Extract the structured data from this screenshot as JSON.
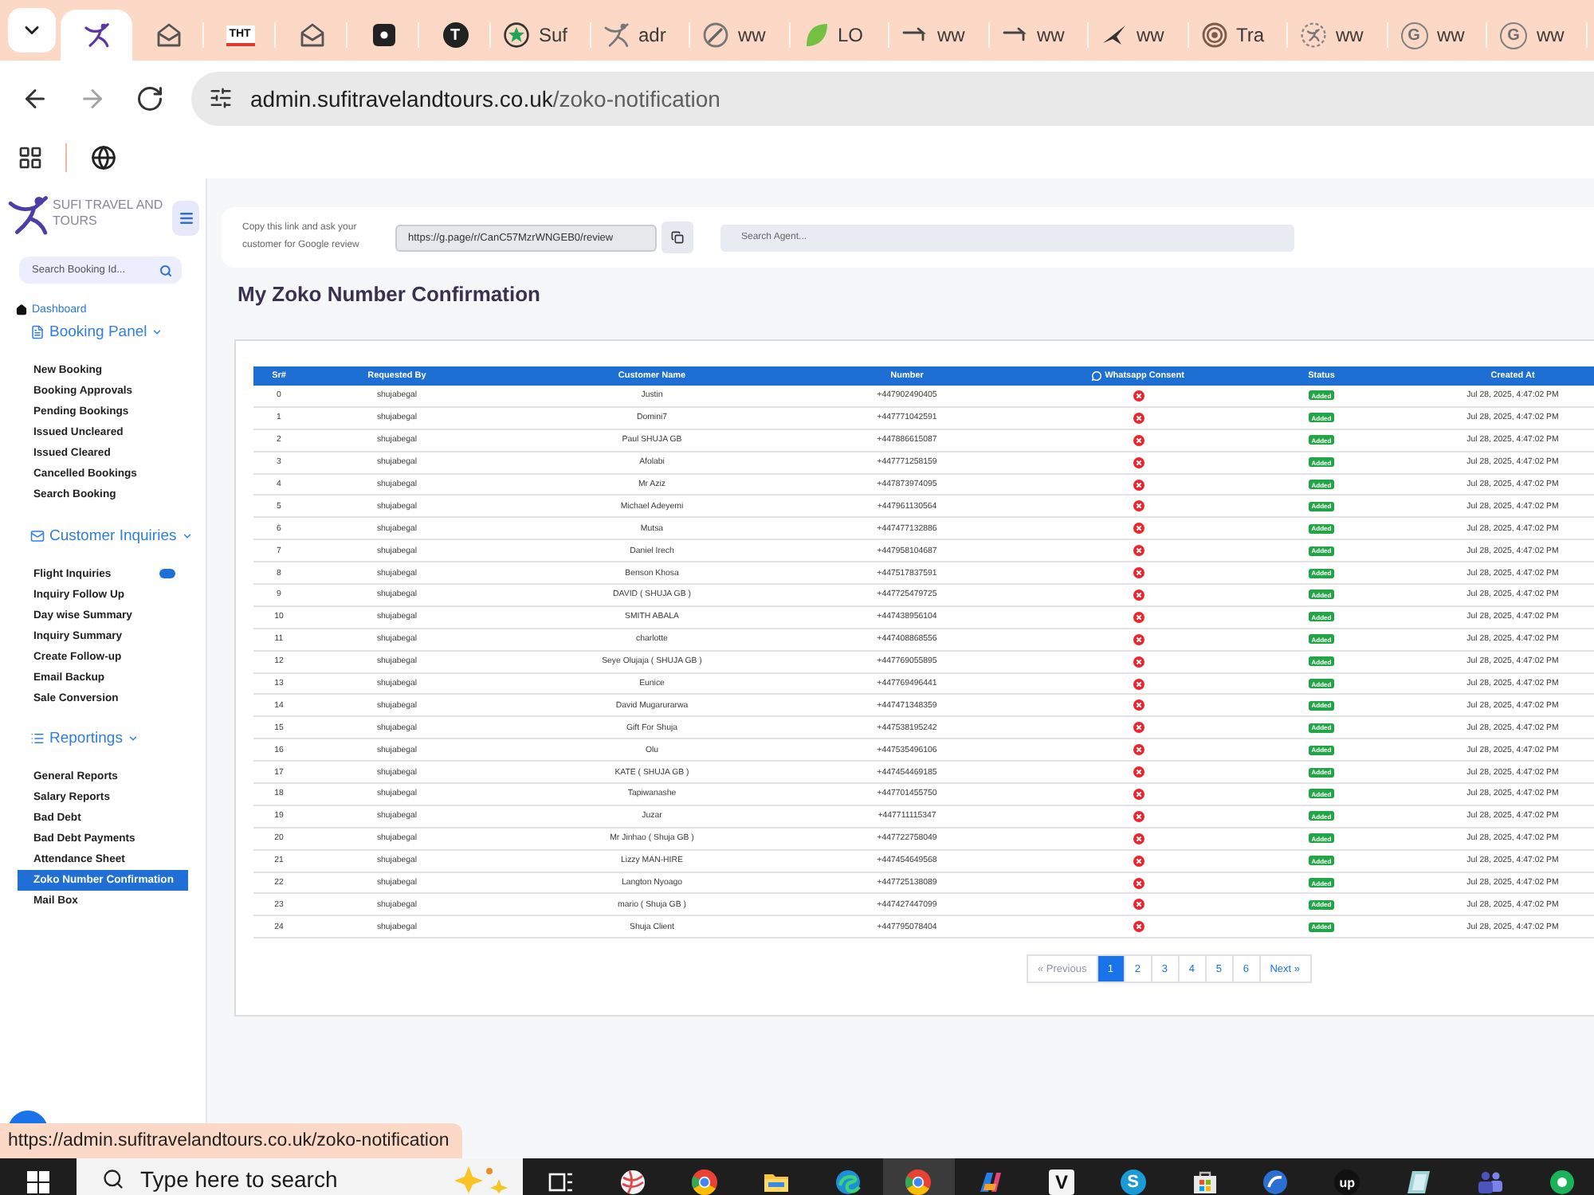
{
  "browser": {
    "tabs": [
      {
        "selected": true
      },
      {
        "selected": false
      },
      {
        "logo_text": "THT",
        "selected": false
      },
      {
        "selected": false
      },
      {
        "selected": false
      },
      {
        "logo_text": "T",
        "selected": false
      },
      {
        "title": "Suf",
        "selected": false
      },
      {
        "title": "adr",
        "selected": false
      },
      {
        "title": "ww",
        "selected": false
      },
      {
        "title": "LO",
        "selected": false
      },
      {
        "title": "ww",
        "selected": false
      },
      {
        "title": "ww",
        "selected": false
      },
      {
        "title": "ww",
        "selected": false
      },
      {
        "title": "Tra",
        "selected": false
      },
      {
        "title": "ww",
        "selected": false
      },
      {
        "logo_text": "G",
        "title": "ww",
        "selected": false
      },
      {
        "logo_text": "G",
        "title": "ww",
        "selected": false
      }
    ],
    "nav": [
      {
        "kind": "back",
        "disabled": false
      },
      {
        "kind": "forward",
        "disabled": true
      },
      {
        "kind": "reload",
        "disabled": false
      }
    ],
    "address": {
      "host": "admin.sufitravelandtours.co.uk",
      "path": "/zoko-notification"
    },
    "status_url": "https://admin.sufitravelandtours.co.uk/zoko-notification"
  },
  "sidebar": {
    "brand": "SUFI TRAVEL AND TOURS",
    "search": {
      "placeholder": "Search Booking Id..."
    },
    "dashboard": "Dashboard",
    "sections": [
      {
        "title": "Booking Panel",
        "expanded": true,
        "items": [
          {
            "label": "New Booking",
            "selected": false,
            "badge": false
          },
          {
            "label": "Booking Approvals",
            "selected": false,
            "badge": false
          },
          {
            "label": "Pending Bookings",
            "selected": false,
            "badge": false
          },
          {
            "label": "Issued Uncleared",
            "selected": false,
            "badge": false
          },
          {
            "label": "Issued Cleared",
            "selected": false,
            "badge": false
          },
          {
            "label": "Cancelled Bookings",
            "selected": false,
            "badge": false
          },
          {
            "label": "Search Booking",
            "selected": false,
            "badge": false
          }
        ]
      },
      {
        "title": "Customer Inquiries",
        "expanded": true,
        "items": [
          {
            "label": "Flight Inquiries",
            "selected": false,
            "badge": true
          },
          {
            "label": "Inquiry Follow Up",
            "selected": false,
            "badge": false
          },
          {
            "label": "Day wise Summary",
            "selected": false,
            "badge": false
          },
          {
            "label": "Inquiry Summary",
            "selected": false,
            "badge": false
          },
          {
            "label": "Create Follow-up",
            "selected": false,
            "badge": false
          },
          {
            "label": "Email Backup",
            "selected": false,
            "badge": false
          },
          {
            "label": "Sale Conversion",
            "selected": false,
            "badge": false
          }
        ]
      },
      {
        "title": "Reportings",
        "expanded": true,
        "items": [
          {
            "label": "General Reports",
            "selected": false,
            "badge": false
          },
          {
            "label": "Salary Reports",
            "selected": false,
            "badge": false
          },
          {
            "label": "Bad Debt",
            "selected": false,
            "badge": false
          },
          {
            "label": "Bad Debt Payments",
            "selected": false,
            "badge": false
          },
          {
            "label": "Attendance Sheet",
            "selected": false,
            "badge": false
          },
          {
            "label": "Zoko Number Confirmation",
            "selected": true,
            "badge": false
          },
          {
            "label": "Mail Box",
            "selected": false,
            "badge": false
          }
        ]
      }
    ]
  },
  "review": {
    "hint": "Copy this link and ask your customer for Google review",
    "link": "https://g.page/r/CanC57MzrWNGEB0/review"
  },
  "agent_search": {
    "placeholder": "Search Agent..."
  },
  "page_title": "My Zoko Number Confirmation",
  "table": {
    "columns": [
      "Sr#",
      "Requested By",
      "Customer Name",
      "Number",
      "Whatsapp Consent",
      "Status",
      "Created At"
    ],
    "rows": [
      {
        "sr": "0",
        "requested_by": "shujabegal",
        "customer": "Justin",
        "number": "+447902490405",
        "consent": false,
        "status": "Added",
        "created": "Jul 28, 2025, 4:47:02 PM"
      },
      {
        "sr": "1",
        "requested_by": "shujabegal",
        "customer": "Domini7",
        "number": "+447771042591",
        "consent": false,
        "status": "Added",
        "created": "Jul 28, 2025, 4:47:02 PM"
      },
      {
        "sr": "2",
        "requested_by": "shujabegal",
        "customer": "Paul SHUJA GB",
        "number": "+447886615087",
        "consent": false,
        "status": "Added",
        "created": "Jul 28, 2025, 4:47:02 PM"
      },
      {
        "sr": "3",
        "requested_by": "shujabegal",
        "customer": "Afolabi",
        "number": "+447771258159",
        "consent": false,
        "status": "Added",
        "created": "Jul 28, 2025, 4:47:02 PM"
      },
      {
        "sr": "4",
        "requested_by": "shujabegal",
        "customer": "Mr Aziz",
        "number": "+447873974095",
        "consent": false,
        "status": "Added",
        "created": "Jul 28, 2025, 4:47:02 PM"
      },
      {
        "sr": "5",
        "requested_by": "shujabegal",
        "customer": "Michael Adeyemi",
        "number": "+447961130564",
        "consent": false,
        "status": "Added",
        "created": "Jul 28, 2025, 4:47:02 PM"
      },
      {
        "sr": "6",
        "requested_by": "shujabegal",
        "customer": "Mutsa",
        "number": "+447477132886",
        "consent": false,
        "status": "Added",
        "created": "Jul 28, 2025, 4:47:02 PM"
      },
      {
        "sr": "7",
        "requested_by": "shujabegal",
        "customer": "Daniel Irech",
        "number": "+447958104687",
        "consent": false,
        "status": "Added",
        "created": "Jul 28, 2025, 4:47:02 PM"
      },
      {
        "sr": "8",
        "requested_by": "shujabegal",
        "customer": "Benson Khosa",
        "number": "+447517837591",
        "consent": false,
        "status": "Added",
        "created": "Jul 28, 2025, 4:47:02 PM"
      },
      {
        "sr": "9",
        "requested_by": "shujabegal",
        "customer": "DAVID ( SHUJA GB )",
        "number": "+447725479725",
        "consent": false,
        "status": "Added",
        "created": "Jul 28, 2025, 4:47:02 PM"
      },
      {
        "sr": "10",
        "requested_by": "shujabegal",
        "customer": "SMITH ABALA",
        "number": "+447438956104",
        "consent": false,
        "status": "Added",
        "created": "Jul 28, 2025, 4:47:02 PM"
      },
      {
        "sr": "11",
        "requested_by": "shujabegal",
        "customer": "charlotte",
        "number": "+447408868556",
        "consent": false,
        "status": "Added",
        "created": "Jul 28, 2025, 4:47:02 PM"
      },
      {
        "sr": "12",
        "requested_by": "shujabegal",
        "customer": "Seye Olujaja ( SHUJA GB )",
        "number": "+447769055895",
        "consent": false,
        "status": "Added",
        "created": "Jul 28, 2025, 4:47:02 PM"
      },
      {
        "sr": "13",
        "requested_by": "shujabegal",
        "customer": "Eunice",
        "number": "+447769496441",
        "consent": false,
        "status": "Added",
        "created": "Jul 28, 2025, 4:47:02 PM"
      },
      {
        "sr": "14",
        "requested_by": "shujabegal",
        "customer": "David Mugarurarwa",
        "number": "+447471348359",
        "consent": false,
        "status": "Added",
        "created": "Jul 28, 2025, 4:47:02 PM"
      },
      {
        "sr": "15",
        "requested_by": "shujabegal",
        "customer": "Gift For Shuja",
        "number": "+447538195242",
        "consent": false,
        "status": "Added",
        "created": "Jul 28, 2025, 4:47:02 PM"
      },
      {
        "sr": "16",
        "requested_by": "shujabegal",
        "customer": "Olu",
        "number": "+447535496106",
        "consent": false,
        "status": "Added",
        "created": "Jul 28, 2025, 4:47:02 PM"
      },
      {
        "sr": "17",
        "requested_by": "shujabegal",
        "customer": "KATE ( SHUJA GB )",
        "number": "+447454469185",
        "consent": false,
        "status": "Added",
        "created": "Jul 28, 2025, 4:47:02 PM"
      },
      {
        "sr": "18",
        "requested_by": "shujabegal",
        "customer": "Tapiwanashe",
        "number": "+447701455750",
        "consent": false,
        "status": "Added",
        "created": "Jul 28, 2025, 4:47:02 PM"
      },
      {
        "sr": "19",
        "requested_by": "shujabegal",
        "customer": "Juzar",
        "number": "+447711115347",
        "consent": false,
        "status": "Added",
        "created": "Jul 28, 2025, 4:47:02 PM"
      },
      {
        "sr": "20",
        "requested_by": "shujabegal",
        "customer": "Mr Jinhao ( Shuja GB )",
        "number": "+447722758049",
        "consent": false,
        "status": "Added",
        "created": "Jul 28, 2025, 4:47:02 PM"
      },
      {
        "sr": "21",
        "requested_by": "shujabegal",
        "customer": "Lizzy MAN-HIRE",
        "number": "+447454649568",
        "consent": false,
        "status": "Added",
        "created": "Jul 28, 2025, 4:47:02 PM"
      },
      {
        "sr": "22",
        "requested_by": "shujabegal",
        "customer": "Langton Nyoago",
        "number": "+447725138089",
        "consent": false,
        "status": "Added",
        "created": "Jul 28, 2025, 4:47:02 PM"
      },
      {
        "sr": "23",
        "requested_by": "shujabegal",
        "customer": "mario ( Shuja GB )",
        "number": "+447427447099",
        "consent": false,
        "status": "Added",
        "created": "Jul 28, 2025, 4:47:02 PM"
      },
      {
        "sr": "24",
        "requested_by": "shujabegal",
        "customer": "Shuja Client",
        "number": "+447795078404",
        "consent": false,
        "status": "Added",
        "created": "Jul 28, 2025, 4:47:02 PM"
      }
    ]
  },
  "pagination": {
    "previous": {
      "label": "« Previous",
      "disabled": true
    },
    "pages": [
      {
        "label": "1",
        "selected": true
      },
      {
        "label": "2",
        "selected": false
      },
      {
        "label": "3",
        "selected": false
      },
      {
        "label": "4",
        "selected": false
      },
      {
        "label": "5",
        "selected": false
      },
      {
        "label": "6",
        "selected": false
      }
    ],
    "next": {
      "label": "Next »",
      "disabled": false
    }
  },
  "taskbar": {
    "search": {
      "placeholder": "Type here to search"
    },
    "apps": [
      {
        "selected": false
      },
      {
        "selected": false
      },
      {
        "selected": false
      },
      {
        "selected": false
      },
      {
        "selected": false
      },
      {
        "selected": true
      },
      {
        "selected": false
      },
      {
        "logo_text": "V",
        "selected": false
      },
      {
        "logo_text": "S",
        "selected": false
      },
      {
        "selected": false
      },
      {
        "selected": false
      },
      {
        "logo_text": "up",
        "selected": false
      },
      {
        "selected": false
      },
      {
        "selected": false
      },
      {
        "selected": false
      }
    ]
  }
}
